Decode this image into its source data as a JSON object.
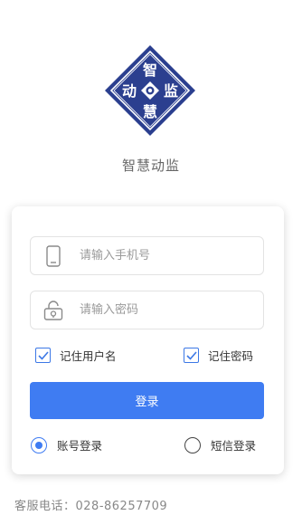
{
  "brand": {
    "app_name": "智慧动监",
    "logo_chars": [
      "智",
      "监",
      "慧",
      "动"
    ],
    "logo_color": "#2b3f8f"
  },
  "form": {
    "phone_placeholder": "请输入手机号",
    "password_placeholder": "请输入密码",
    "remember_username": {
      "label": "记住用户名",
      "checked": true
    },
    "remember_password": {
      "label": "记住密码",
      "checked": true
    },
    "login_button": "登录",
    "login_modes": [
      {
        "label": "账号登录",
        "selected": true
      },
      {
        "label": "短信登录",
        "selected": false
      }
    ]
  },
  "footer": {
    "service_phone": "客服电话：028-86257709"
  },
  "colors": {
    "accent": "#3f7cf2",
    "logo": "#2b3f8f"
  }
}
